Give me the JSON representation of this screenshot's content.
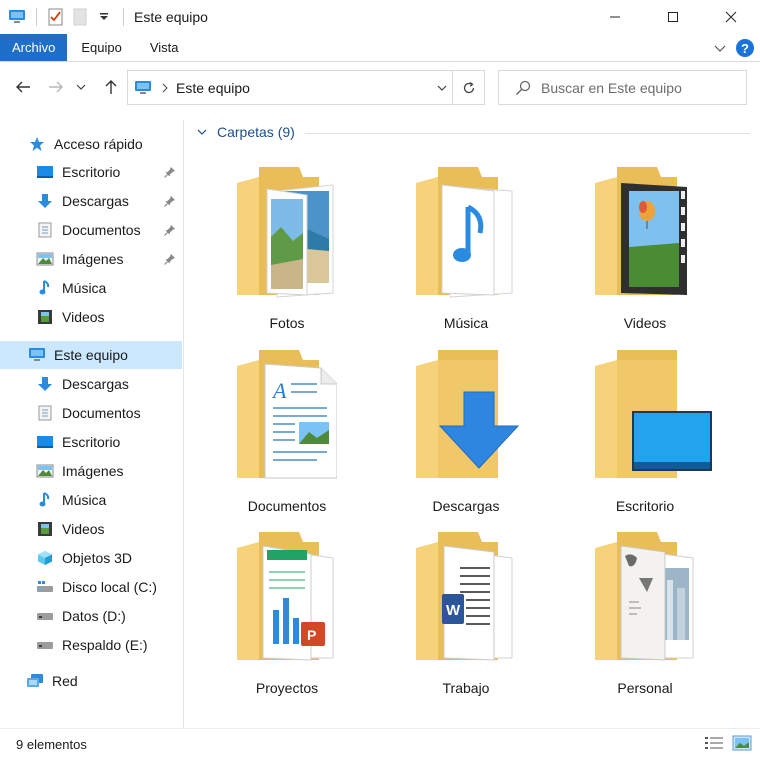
{
  "window": {
    "title": "Este equipo",
    "controls": [
      "minimize-icon",
      "maximize-icon",
      "close-icon"
    ]
  },
  "ribbon": {
    "tabs": [
      "Archivo",
      "Equipo",
      "Vista"
    ],
    "help": "?"
  },
  "address": {
    "path": "Este equipo",
    "search_placeholder": "Buscar en Este equipo"
  },
  "sidebar": {
    "quick_access": "Acceso rápido",
    "quick_items": [
      "Escritorio",
      "Descargas",
      "Documentos",
      "Imágenes",
      "Música",
      "Videos"
    ],
    "this_pc": "Este equipo",
    "pc_items": [
      "Descargas",
      "Documentos",
      "Escritorio",
      "Imágenes",
      "Música",
      "Videos",
      "Objetos 3D",
      "Disco local (C:)",
      "Datos (D:)",
      "Respaldo (E:)"
    ],
    "network": "Red"
  },
  "main": {
    "group_title": "Carpetas (9)",
    "folders": [
      "Fotos",
      "Música",
      "Videos",
      "Documentos",
      "Descargas",
      "Escritorio",
      "Proyectos",
      "Trabajo",
      "Personal"
    ]
  },
  "status": {
    "count": "9 elementos"
  },
  "colors": {
    "accent": "#1e6fc8",
    "selection": "#cce8ff",
    "folder": "#f6d27a",
    "folder_dark": "#e9bd58"
  }
}
